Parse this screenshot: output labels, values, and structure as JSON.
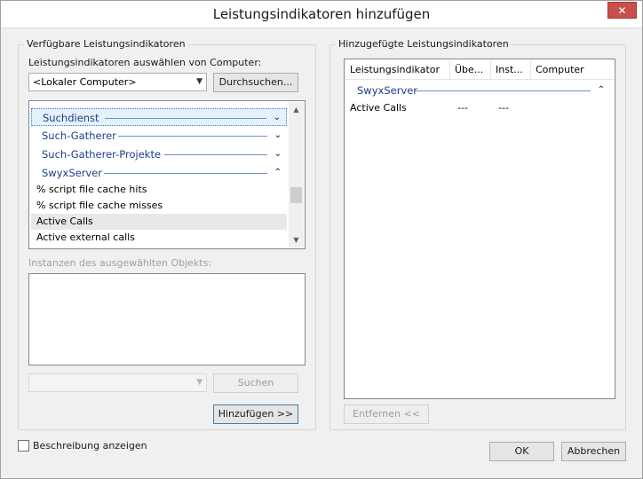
{
  "window": {
    "title": "Leistungsindikatoren hinzufügen",
    "close_glyph": "✕"
  },
  "left": {
    "group_label": "Verfügbare Leistungsindikatoren",
    "computer_label": "Leistungsindikatoren auswählen von Computer:",
    "computer_value": "<Lokaler Computer>",
    "browse_label": "Durchsuchen...",
    "objects": [
      {
        "label": "Suchdienst",
        "expanded": false,
        "selected": true
      },
      {
        "label": "Such-Gatherer",
        "expanded": false,
        "selected": false
      },
      {
        "label": "Such-Gatherer-Projekte",
        "expanded": false,
        "selected": false
      },
      {
        "label": "SwyxServer",
        "expanded": true,
        "selected": false
      }
    ],
    "counters": [
      {
        "label": "% script file cache hits",
        "highlighted": false
      },
      {
        "label": "% script file cache misses",
        "highlighted": false
      },
      {
        "label": "Active Calls",
        "highlighted": true
      },
      {
        "label": "Active external calls",
        "highlighted": false
      }
    ],
    "instances_label": "Instanzen des ausgewählten Objekts:",
    "search_value": "",
    "search_label": "Suchen",
    "add_label": "Hinzufügen >>"
  },
  "right": {
    "group_label": "Hinzugefügte Leistungsindikatoren",
    "columns": [
      "Leistungsindikator",
      "Übe...",
      "Inst...",
      "Computer"
    ],
    "group_name": "SwyxServer",
    "rows": [
      {
        "counter": "Active Calls",
        "parent": "---",
        "instance": "---",
        "computer": ""
      }
    ],
    "remove_label": "Entfernen <<"
  },
  "footer": {
    "show_description_label": "Beschreibung anzeigen",
    "show_description_checked": false,
    "ok_label": "OK",
    "cancel_label": "Abbrechen"
  },
  "icons": {
    "chevron_down": "❯",
    "chevron_up": "❮",
    "scroll_up": "▲",
    "scroll_down": "▼",
    "combo_arrow": "⌄"
  }
}
